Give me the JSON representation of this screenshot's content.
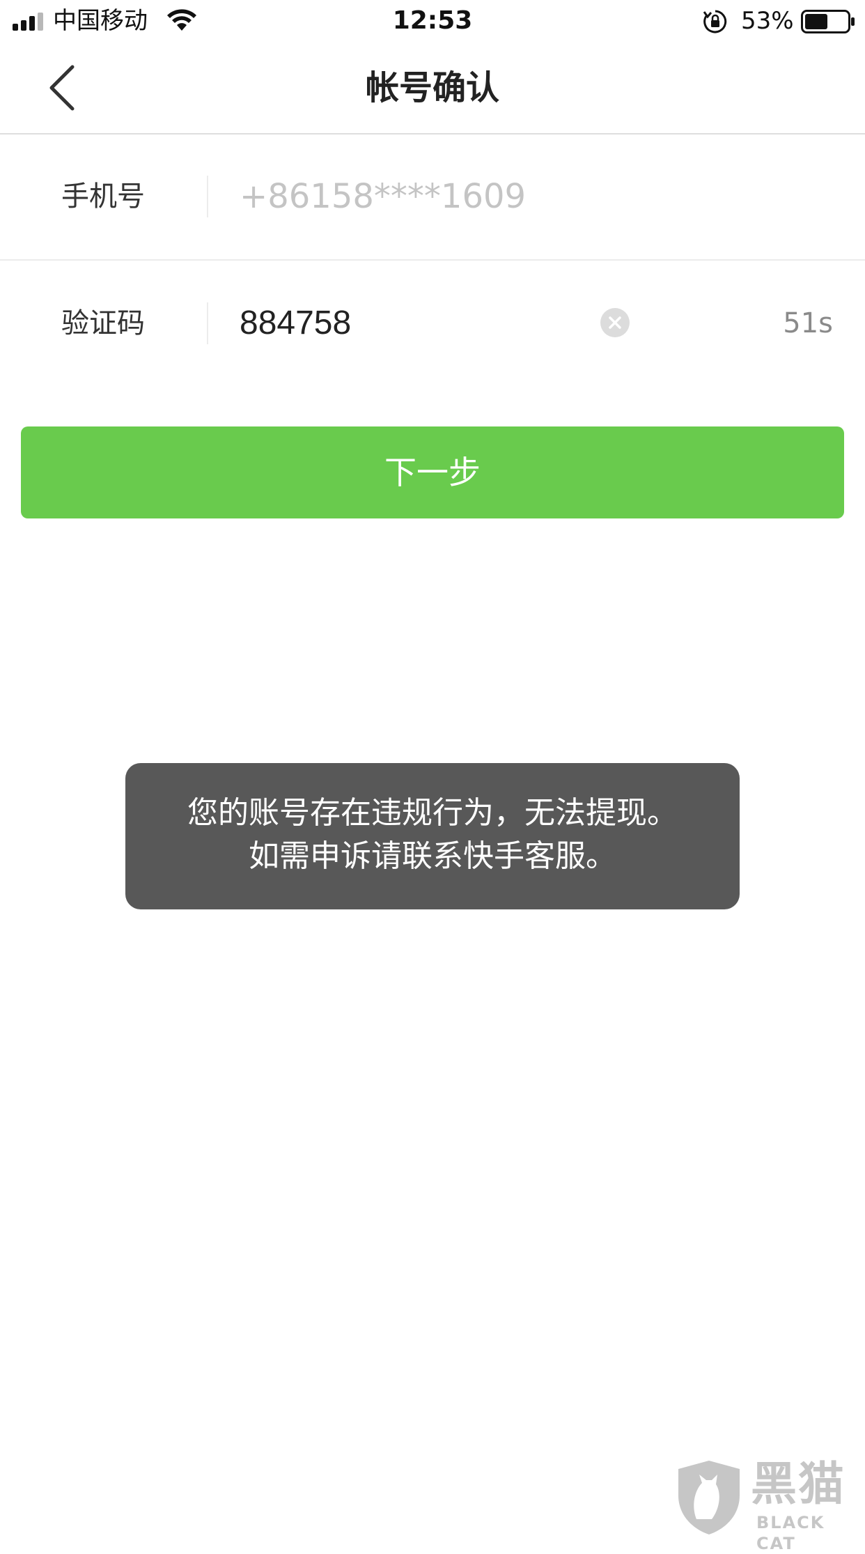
{
  "status_bar": {
    "carrier": "中国移动",
    "time": "12:53",
    "battery_percent": "53%",
    "battery_level": 0.53
  },
  "nav": {
    "title": "帐号确认",
    "back_icon": "chevron-left-icon"
  },
  "form": {
    "phone": {
      "label": "手机号",
      "value": "+86158****1609"
    },
    "code": {
      "label": "验证码",
      "value": "884758",
      "countdown": "51s",
      "clear_icon": "clear-circle-icon"
    }
  },
  "next_button": {
    "label": "下一步"
  },
  "toast": {
    "line1": "您的账号存在违规行为，无法提现。",
    "line2": "如需申诉请联系快手客服。"
  },
  "watermark": {
    "cn": "黑猫",
    "en": "BLACK CAT"
  },
  "colors": {
    "accent_green": "#69cb4d",
    "toast_bg": "#585858",
    "placeholder_gray": "#c4c4c4"
  }
}
